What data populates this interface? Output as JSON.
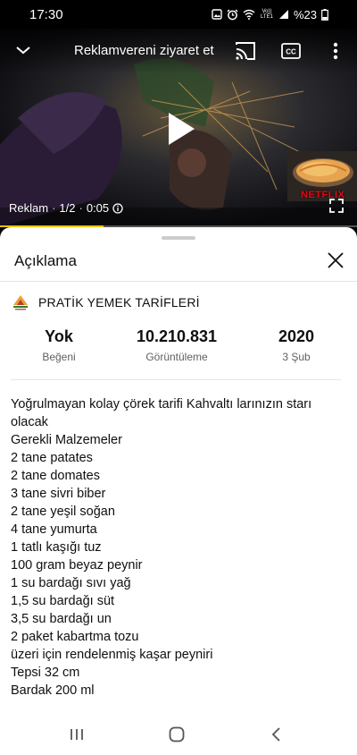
{
  "status_bar": {
    "time": "17:30",
    "network_label": "Vo)) LTE1",
    "battery": "%23"
  },
  "video": {
    "ad_link_text": "Reklamvereni ziyaret et",
    "ad_label": "Reklam",
    "ad_position": "1/2",
    "ad_time": "0:05",
    "sponsor_brand": "NETFLIX",
    "progress_fraction": 0.29,
    "accent_color": "#f2c200"
  },
  "sheet": {
    "title": "Açıklama",
    "channel_name": "PRATİK YEMEK TARİFLERİ",
    "stats": [
      {
        "value": "Yok",
        "label": "Beğeni"
      },
      {
        "value": "10.210.831",
        "label": "Görüntüleme"
      },
      {
        "value": "2020",
        "label": "3 Şub"
      }
    ],
    "description_lines": [
      "Yoğrulmayan kolay çörek tarifi Kahvaltı larınızın starı olacak",
      "Gerekli Malzemeler",
      "2 tane patates",
      "2 tane domates",
      "3 tane sivri biber",
      "2 tane yeşil soğan",
      "4 tane yumurta",
      "1 tatlı kaşığı tuz",
      "100 gram beyaz peynir",
      "1 su bardağı sıvı yağ",
      "1,5 su bardağı süt",
      "3,5 su bardağı un",
      "2 paket kabartma tozu",
      "üzeri için rendelenmiş kaşar peyniri",
      "Tepsi 32 cm",
      "Bardak 200 ml"
    ]
  },
  "navigation": {
    "icons": [
      "recent-apps-icon",
      "home-icon",
      "back-icon"
    ]
  }
}
